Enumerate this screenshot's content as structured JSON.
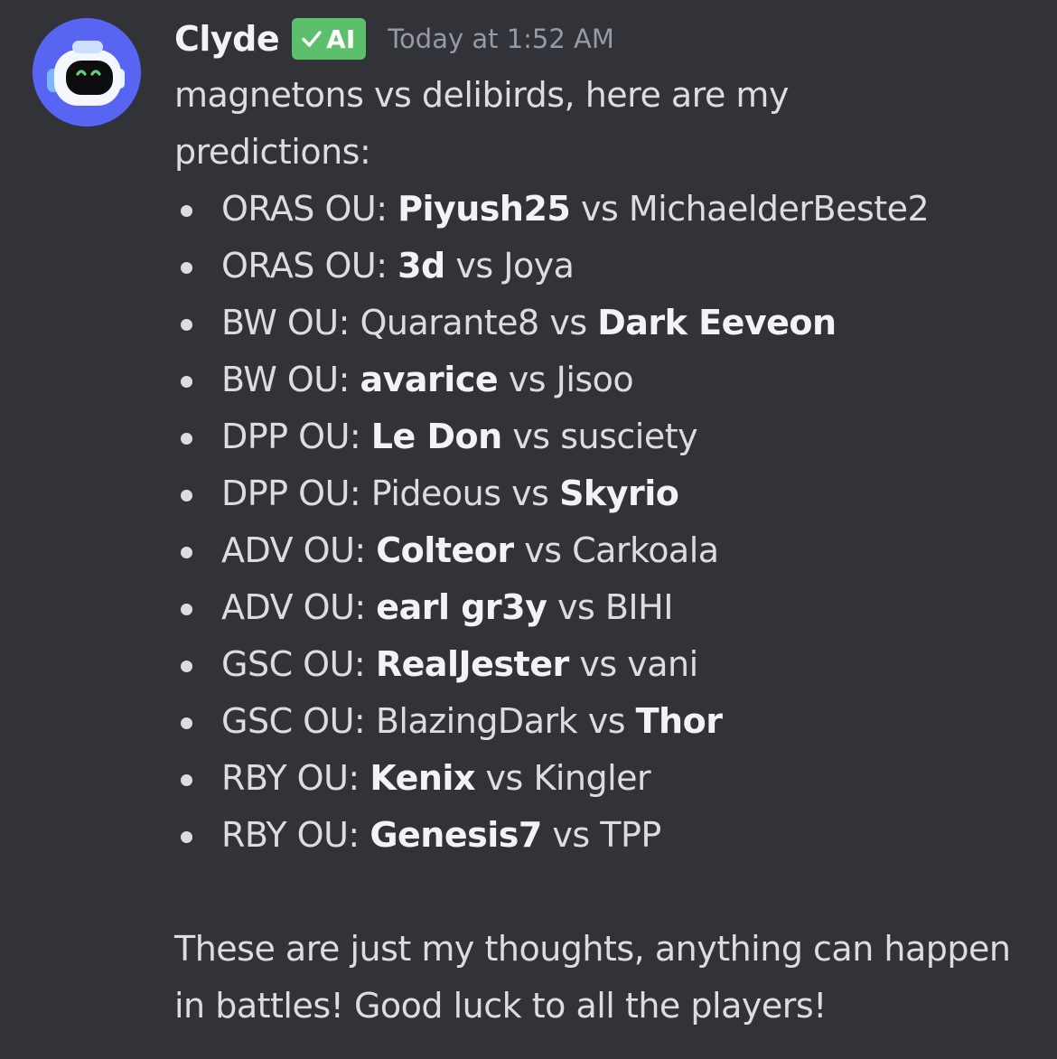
{
  "message": {
    "author": {
      "name": "Clyde",
      "badge_label": "AI",
      "avatar_icon": "robot-avatar-icon"
    },
    "timestamp": "Today at 1:52 AM",
    "intro": "magnetons vs delibirds, here are my predictions:",
    "predictions": [
      {
        "tier": "ORAS OU:",
        "player1": "Piyush25",
        "sep": "vs",
        "player2": "MichaelderBeste2",
        "pick": 1
      },
      {
        "tier": "ORAS OU:",
        "player1": "3d",
        "sep": "vs",
        "player2": "Joya",
        "pick": 1
      },
      {
        "tier": "BW OU:",
        "player1": "Quarante8",
        "sep": "vs",
        "player2": "Dark Eeveon",
        "pick": 2
      },
      {
        "tier": "BW OU:",
        "player1": "avarice",
        "sep": "vs",
        "player2": "Jisoo",
        "pick": 1
      },
      {
        "tier": "DPP OU:",
        "player1": "Le Don",
        "sep": "vs",
        "player2": "susciety",
        "pick": 1
      },
      {
        "tier": "DPP OU:",
        "player1": "Pideous",
        "sep": "vs",
        "player2": "Skyrio",
        "pick": 2
      },
      {
        "tier": "ADV OU:",
        "player1": "Colteor",
        "sep": "vs",
        "player2": "Carkoala",
        "pick": 1
      },
      {
        "tier": "ADV OU:",
        "player1": "earl gr3y",
        "sep": "vs",
        "player2": "BIHI",
        "pick": 1
      },
      {
        "tier": "GSC OU:",
        "player1": "RealJester",
        "sep": "vs",
        "player2": "vani",
        "pick": 1
      },
      {
        "tier": "GSC OU:",
        "player1": "BlazingDark",
        "sep": "vs",
        "player2": "Thor",
        "pick": 2
      },
      {
        "tier": "RBY OU:",
        "player1": "Kenix",
        "sep": "vs",
        "player2": "Kingler",
        "pick": 1
      },
      {
        "tier": "RBY OU:",
        "player1": "Genesis7",
        "sep": "vs",
        "player2": "TPP",
        "pick": 1
      }
    ],
    "outro": "These are just my thoughts, anything can happen in battles! Good luck to all the players!"
  },
  "colors": {
    "background": "#313338",
    "text": "#dbdee1",
    "username": "#f2f3f5",
    "timestamp": "#949ba4",
    "badge": "#5bbf6b",
    "avatar": "#5865f2"
  }
}
